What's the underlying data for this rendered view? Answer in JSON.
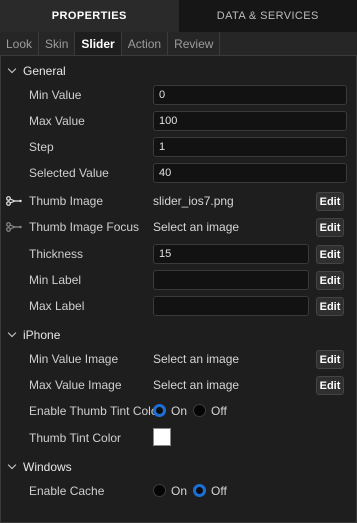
{
  "top_tabs": {
    "properties": "PROPERTIES",
    "data_services": "DATA & SERVICES"
  },
  "sub_tabs": [
    "Look",
    "Skin",
    "Slider",
    "Action",
    "Review"
  ],
  "sections": {
    "general": "General",
    "iphone": "iPhone",
    "windows": "Windows"
  },
  "general": {
    "min_value": {
      "label": "Min Value",
      "value": "0"
    },
    "max_value": {
      "label": "Max Value",
      "value": "100"
    },
    "step": {
      "label": "Step",
      "value": "1"
    },
    "selected_value": {
      "label": "Selected Value",
      "value": "40"
    },
    "thumb_image": {
      "label": "Thumb Image",
      "value": "slider_ios7.png"
    },
    "thumb_image_focus": {
      "label": "Thumb Image Focus",
      "value": "Select an image"
    },
    "thickness": {
      "label": "Thickness",
      "value": "15"
    },
    "min_label": {
      "label": "Min Label",
      "value": ""
    },
    "max_label": {
      "label": "Max Label",
      "value": ""
    }
  },
  "iphone": {
    "min_value_image": {
      "label": "Min Value Image",
      "value": "Select an image"
    },
    "max_value_image": {
      "label": "Max Value Image",
      "value": "Select an image"
    },
    "enable_thumb_tint": {
      "label": "Enable Thumb Tint Color",
      "on": "On",
      "off": "Off",
      "selected": "On"
    },
    "thumb_tint_color": {
      "label": "Thumb Tint Color",
      "color": "#ffffff"
    }
  },
  "windows": {
    "enable_cache": {
      "label": "Enable Cache",
      "on": "On",
      "off": "Off",
      "selected": "Off"
    }
  },
  "edit_label": "Edit",
  "colors": {
    "accent": "#1c6fd6",
    "background": "#1e1e1e"
  },
  "icons": {
    "linked": "link-icon"
  }
}
